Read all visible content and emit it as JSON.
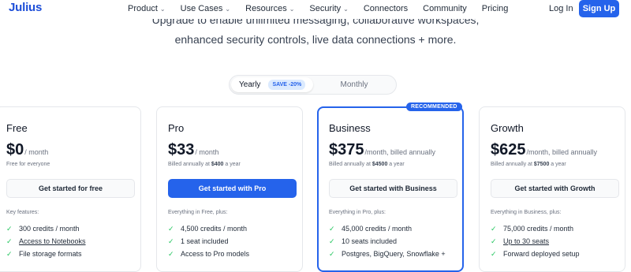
{
  "nav": {
    "logo": "Julius",
    "items": [
      {
        "label": "Product",
        "has_dropdown": true
      },
      {
        "label": "Use Cases",
        "has_dropdown": true
      },
      {
        "label": "Resources",
        "has_dropdown": true
      },
      {
        "label": "Security",
        "has_dropdown": true
      },
      {
        "label": "Connectors",
        "has_dropdown": false
      },
      {
        "label": "Community",
        "has_dropdown": false
      },
      {
        "label": "Pricing",
        "has_dropdown": false
      }
    ],
    "login": "Log In",
    "signup": "Sign Up"
  },
  "hero": {
    "line1": "Upgrade to enable unlimited messaging, collaborative workspaces,",
    "line2": "enhanced security controls, live data connections + more."
  },
  "billing_toggle": {
    "yearly": "Yearly",
    "save_badge": "SAVE -20%",
    "monthly": "Monthly",
    "selected": "Yearly"
  },
  "plans": [
    {
      "name": "Free",
      "price": "$0",
      "period": "/ month",
      "billed_prefix": "Free for everyone",
      "billed_amount": "",
      "billed_suffix": "",
      "cta": "Get started for free",
      "features_title": "Key features:",
      "features": [
        "300 credits / month",
        "Access to Notebooks",
        "File storage formats"
      ],
      "underlined": [
        false,
        true,
        false
      ]
    },
    {
      "name": "Pro",
      "price": "$33",
      "period": "/ month",
      "billed_prefix": "Billed annually at ",
      "billed_amount": "$400",
      "billed_suffix": " a year",
      "cta": "Get started with Pro",
      "features_title": "Everything in Free, plus:",
      "features": [
        "4,500 credits / month",
        "1 seat included",
        "Access to Pro models"
      ],
      "underlined": [
        false,
        false,
        false
      ]
    },
    {
      "name": "Business",
      "badge": "RECOMMENDED",
      "price": "$375",
      "period": "/month, billed annually",
      "billed_prefix": "Billed annually at ",
      "billed_amount": "$4500",
      "billed_suffix": " a year",
      "cta": "Get started with Business",
      "features_title": "Everything in Pro, plus:",
      "features": [
        "45,000 credits / month",
        "10 seats included",
        "Postgres, BigQuery, Snowflake +"
      ],
      "underlined": [
        false,
        false,
        false
      ]
    },
    {
      "name": "Growth",
      "price": "$625",
      "period": "/month, billed annually",
      "billed_prefix": "Billed annually at ",
      "billed_amount": "$7500",
      "billed_suffix": " a year",
      "cta": "Get started with Growth",
      "features_title": "Everything in Business, plus:",
      "features": [
        "75,000 credits / month",
        "Up to 30 seats",
        "Forward deployed setup"
      ],
      "underlined": [
        false,
        true,
        false
      ]
    }
  ],
  "colors": {
    "accent": "#2563eb",
    "check": "#22c55e",
    "badge_bg": "#dbeafe"
  },
  "icons": {
    "dropdown": "chevron-down-icon",
    "feature": "check-icon"
  }
}
